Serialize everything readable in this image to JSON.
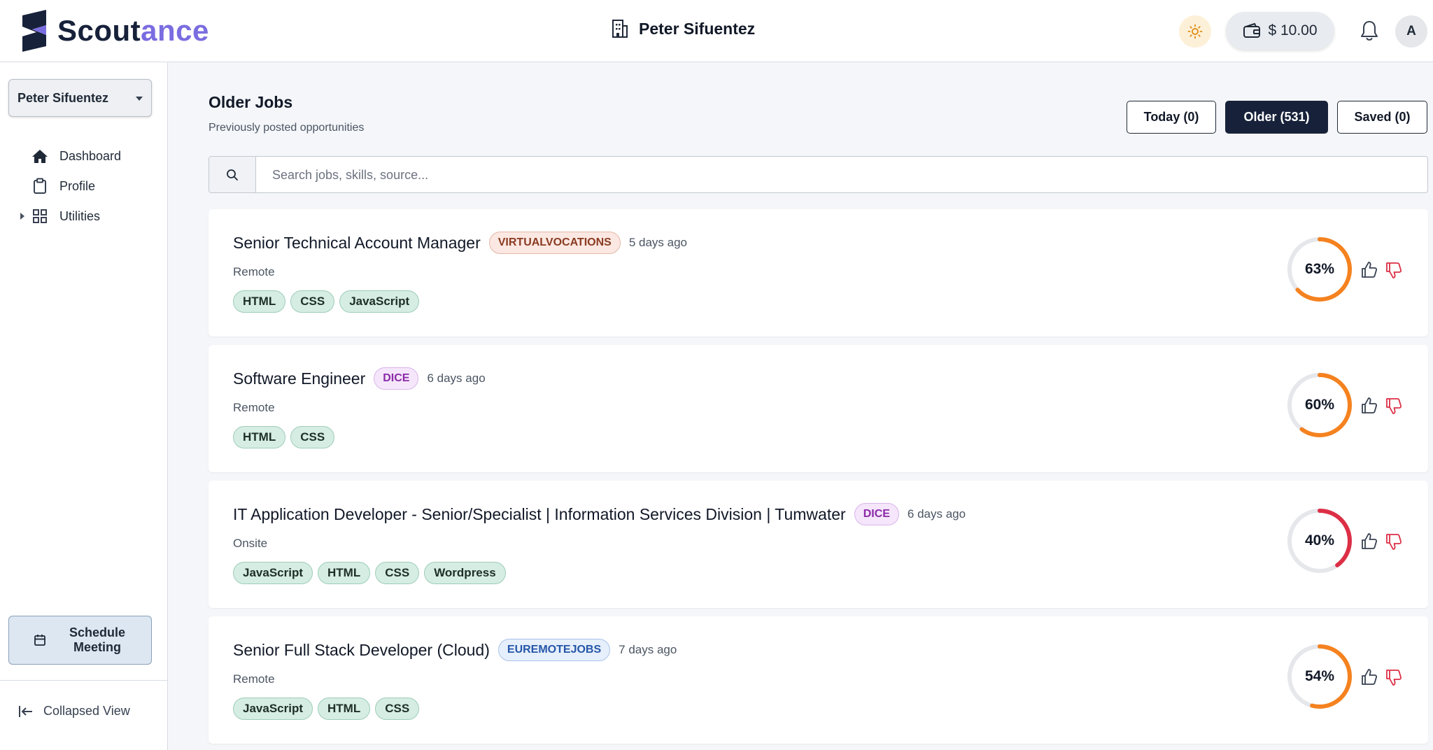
{
  "brand": {
    "prefix": "Scout",
    "accent_part": "ance",
    "accent_color": "#7a6de0",
    "dark_color": "#17213a"
  },
  "header": {
    "company_name": "Peter Sifuentez",
    "wallet_balance": "$ 10.00",
    "avatar_initial": "A",
    "icons": [
      "building-icon",
      "sun-icon",
      "wallet-icon",
      "bell-icon"
    ]
  },
  "sidebar": {
    "user_select": "Peter Sifuentez",
    "nav": [
      {
        "label": "Dashboard",
        "icon": "home-icon"
      },
      {
        "label": "Profile",
        "icon": "clipboard-icon"
      },
      {
        "label": "Utilities",
        "icon": "grid-icon"
      }
    ],
    "schedule_button": "Schedule Meeting",
    "collapse_label": "Collapsed View"
  },
  "main": {
    "title": "Older Jobs",
    "subtitle": "Previously posted opportunities",
    "tabs": [
      {
        "label": "Today (0)",
        "active": false
      },
      {
        "label": "Older (531)",
        "active": true
      },
      {
        "label": "Saved (0)",
        "active": false
      }
    ],
    "search_placeholder": "Search jobs, skills, source...",
    "jobs": [
      {
        "title": "Senior Technical Account Manager",
        "source": "VIRTUALVOCATIONS",
        "age": "5 days ago",
        "location": "Remote",
        "skills": [
          "HTML",
          "CSS",
          "JavaScript"
        ],
        "match": "63%",
        "match_value": 63,
        "ring_color": "#f5821f"
      },
      {
        "title": "Software Engineer",
        "source": "DICE",
        "age": "6 days ago",
        "location": "Remote",
        "skills": [
          "HTML",
          "CSS"
        ],
        "match": "60%",
        "match_value": 60,
        "ring_color": "#f5821f"
      },
      {
        "title": "IT Application Developer - Senior/Specialist | Information Services Division | Tumwater",
        "source": "DICE",
        "age": "6 days ago",
        "location": "Onsite",
        "skills": [
          "JavaScript",
          "HTML",
          "CSS",
          "Wordpress"
        ],
        "match": "40%",
        "match_value": 40,
        "ring_color": "#dc2f45"
      },
      {
        "title": "Senior Full Stack Developer (Cloud)",
        "source": "EUREMOTEJOBS",
        "age": "7 days ago",
        "location": "Remote",
        "skills": [
          "JavaScript",
          "HTML",
          "CSS"
        ],
        "match": "54%",
        "match_value": 54,
        "ring_color": "#f5821f"
      }
    ]
  }
}
